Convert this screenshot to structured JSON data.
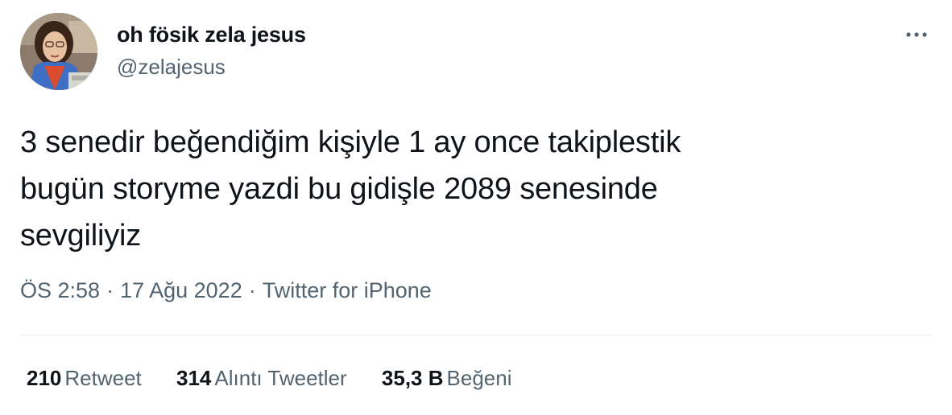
{
  "author": {
    "display_name": "oh fösik zela jesus",
    "handle": "@zelajesus",
    "avatar_icon": "profile-photo"
  },
  "more_icon": "more-horizontal-icon",
  "tweet": {
    "lines": [
      "3 senedir beğendiğim kişiyle 1 ay once takiplestik",
      "bugün storyme yazdi bu gidişle 2089 senesinde",
      "sevgiliyiz"
    ]
  },
  "meta": {
    "time": "ÖS 2:58",
    "separator": "·",
    "date": "17 Ağu 2022",
    "source": "Twitter for iPhone"
  },
  "stats": {
    "retweets": {
      "count": "210",
      "label": "Retweet"
    },
    "quotes": {
      "count": "314",
      "label": "Alıntı Tweetler"
    },
    "likes": {
      "count": "35,3 B",
      "label": "Beğeni"
    }
  },
  "colors": {
    "text_primary": "#0f1419",
    "text_secondary": "#536471",
    "divider": "#e6ecf0"
  }
}
